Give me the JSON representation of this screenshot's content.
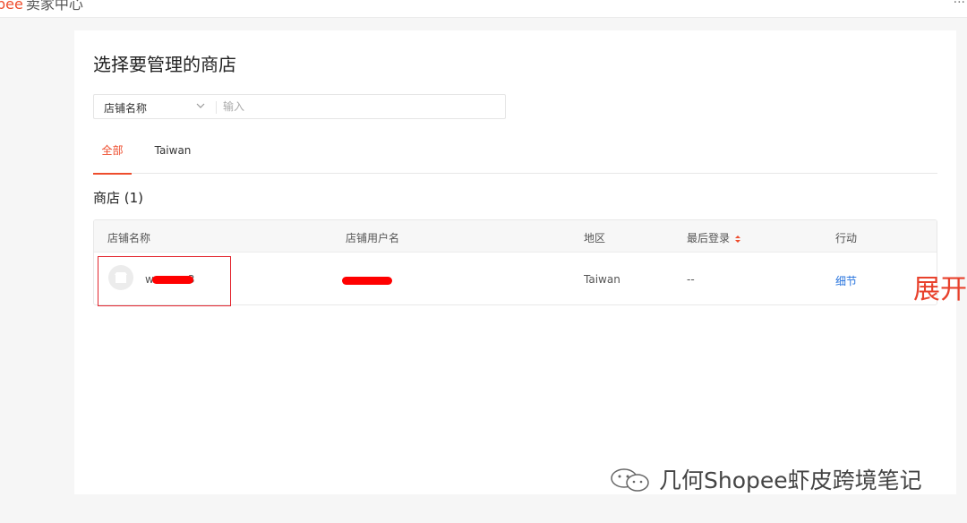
{
  "header": {
    "brand_text": "pee",
    "brand_sub": "卖家中心",
    "user_text": "--..."
  },
  "main": {
    "title": "选择要管理的商店",
    "search": {
      "field_selected": "店铺名称",
      "placeholder": "输入"
    },
    "tabs": [
      {
        "label": "全部",
        "active": true
      },
      {
        "label": "Taiwan",
        "active": false
      }
    ],
    "section_title": "商店 (1)",
    "table": {
      "columns": [
        "店铺名称",
        "店铺用户名",
        "地区",
        "最后登录",
        "行动"
      ],
      "rows": [
        {
          "shop_name": "w",
          "shop_name_suffix": "3",
          "username": "",
          "region": "Taiwan",
          "last_login": "--",
          "action": "细节"
        }
      ]
    }
  },
  "annotations": {
    "expand_note": "展开"
  },
  "watermark": {
    "text": "几何Shopee虾皮跨境笔记"
  },
  "colors": {
    "accent": "#ee4d2d",
    "link": "#2673dd",
    "redaction": "#ff0000"
  }
}
